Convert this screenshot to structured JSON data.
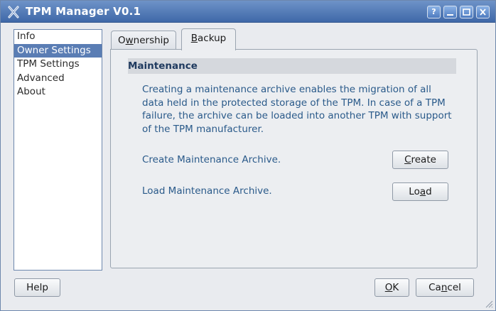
{
  "window": {
    "title": "TPM Manager V0.1"
  },
  "titlebar_buttons": [
    {
      "name": "help-button",
      "glyph": "?"
    },
    {
      "name": "minimize-button",
      "glyph": "_"
    },
    {
      "name": "maximize-button",
      "glyph": "□"
    },
    {
      "name": "close-button",
      "glyph": "✕"
    }
  ],
  "sidebar": {
    "selected_index": 1,
    "items": [
      {
        "label": "Info"
      },
      {
        "label": "Owner Settings"
      },
      {
        "label": "TPM Settings"
      },
      {
        "label": "Advanced"
      },
      {
        "label": "About"
      }
    ]
  },
  "tabs": {
    "active": "Backup",
    "ownership": {
      "pre": "O",
      "mn": "w",
      "post": "nership"
    },
    "backup": {
      "pre": "",
      "mn": "B",
      "post": "ackup"
    }
  },
  "maintenance": {
    "title": "Maintenance",
    "description": "Creating a maintenance archive enables the migration of all data held in the protected storage of the TPM. In case of a TPM failure, the archive can be loaded into another TPM with support of the TPM manufacturer.",
    "create_label": "Create Maintenance Archive.",
    "create_button": {
      "pre": "",
      "mn": "C",
      "post": "reate"
    },
    "load_label": "Load Maintenance Archive.",
    "load_button": {
      "pre": "Lo",
      "mn": "a",
      "post": "d"
    }
  },
  "footer": {
    "help_button": "Help",
    "ok_button": {
      "pre": "",
      "mn": "O",
      "post": "K"
    },
    "cancel_button": {
      "pre": "Ca",
      "mn": "n",
      "post": "cel"
    }
  },
  "colors": {
    "titlebar_top": "#6e93c8",
    "titlebar_bottom": "#3f68a8",
    "selection": "#5a7db4",
    "section_header_bg": "#d5d8dd",
    "body_text": "#2a5a8a"
  }
}
